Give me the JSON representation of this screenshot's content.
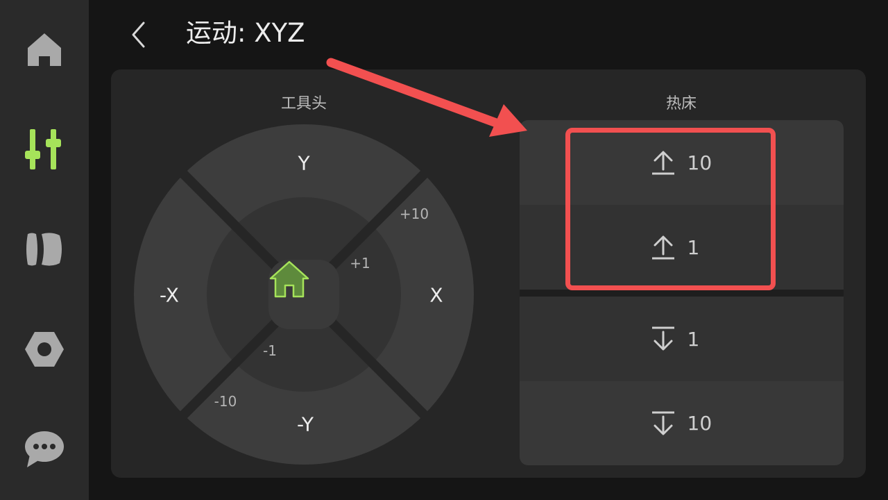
{
  "header": {
    "title": "运动: XYZ"
  },
  "sidebar": {
    "items": [
      {
        "name": "home",
        "active": false
      },
      {
        "name": "controls",
        "active": true
      },
      {
        "name": "filament",
        "active": false
      },
      {
        "name": "settings",
        "active": false
      },
      {
        "name": "messages",
        "active": false
      }
    ]
  },
  "toolhead": {
    "title": "工具头",
    "y_plus": "Y",
    "y_minus": "-Y",
    "x_plus": "X",
    "x_minus": "-X",
    "step_large_plus": "+10",
    "step_small_plus": "+1",
    "step_small_minus": "-1",
    "step_large_minus": "-10"
  },
  "bed": {
    "title": "热床",
    "buttons": [
      {
        "direction": "up",
        "value": "10"
      },
      {
        "direction": "up",
        "value": "1"
      },
      {
        "direction": "down",
        "value": "1"
      },
      {
        "direction": "down",
        "value": "10"
      }
    ]
  },
  "colors": {
    "accent": "#a6e35a",
    "annotation": "#f25050",
    "background": "#151515",
    "panel": "#262626"
  }
}
